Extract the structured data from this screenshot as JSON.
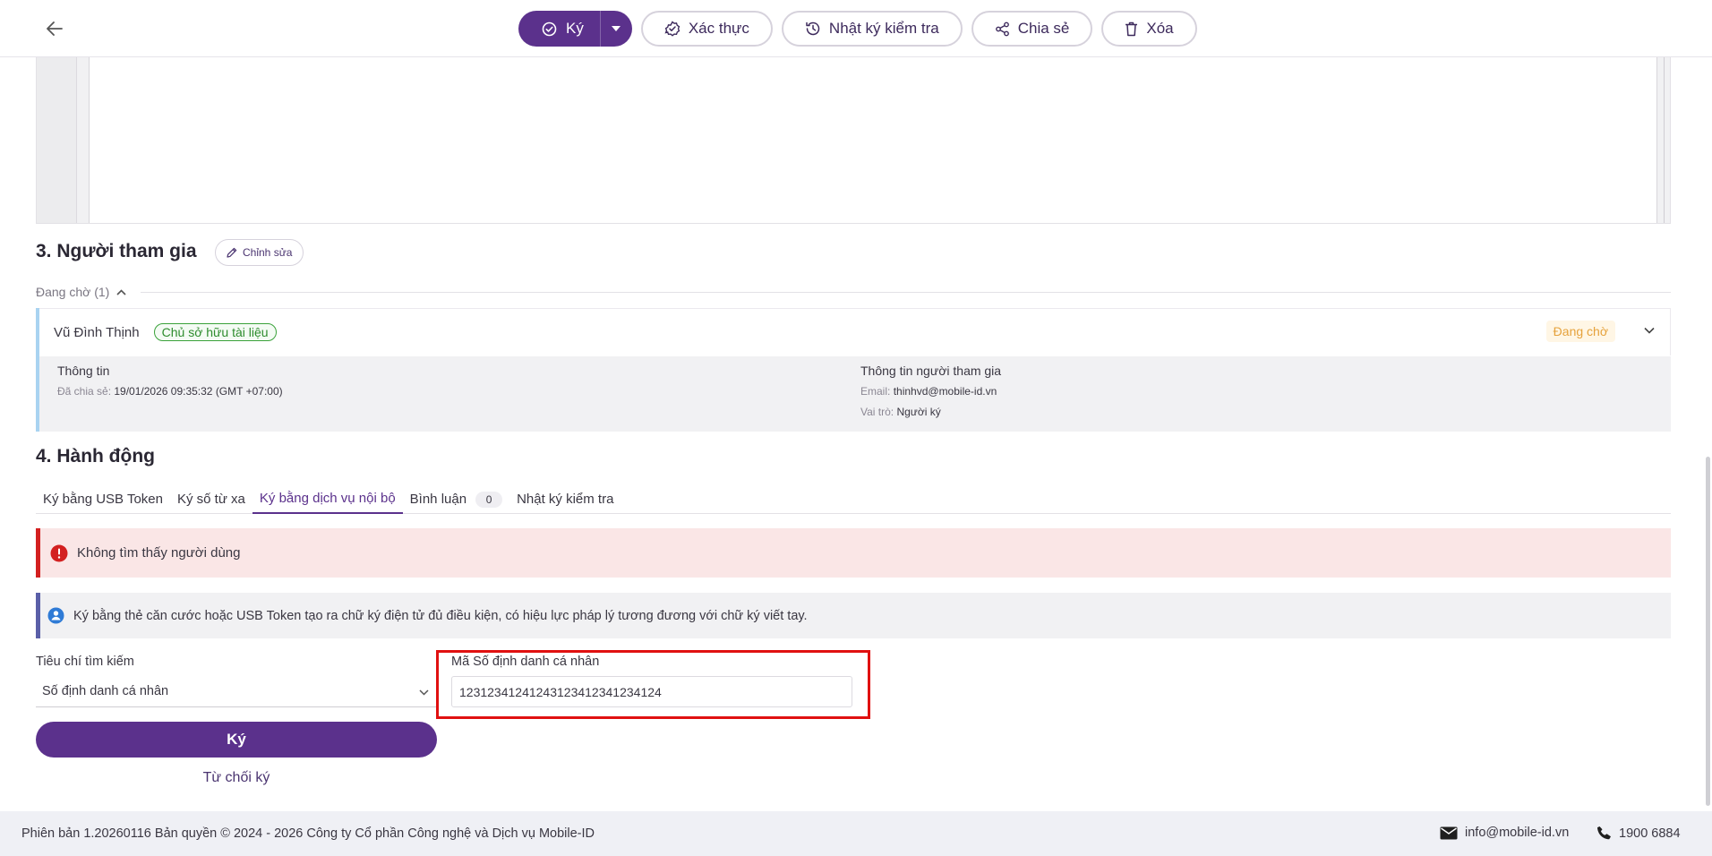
{
  "toolbar": {
    "sign_label": "Ký",
    "verify_label": "Xác thực",
    "audit_label": "Nhật ký kiểm tra",
    "share_label": "Chia sẻ",
    "delete_label": "Xóa",
    "accent": "#5b318c"
  },
  "participants_section": {
    "title": "3. Người tham gia",
    "edit_label": "Chỉnh sửa",
    "group_label": "Đang chờ (1)",
    "participant": {
      "name": "Vũ Đình Thịnh",
      "role_badge": "Chủ sở hữu tài liệu",
      "status": "Đang chờ",
      "info_heading": "Thông tin",
      "shared_label": "Đã chia sẻ:",
      "shared_value": "19/01/2026 09:35:32 (GMT +07:00)",
      "participant_heading": "Thông tin người tham gia",
      "email_label": "Email:",
      "email_value": "thinhvd@mobile-id.vn",
      "role_label": "Vai trò:",
      "role_value": "Người ký"
    }
  },
  "actions_section": {
    "title": "4. Hành động",
    "tabs": [
      {
        "label": "Ký bằng USB Token"
      },
      {
        "label": "Ký số từ xa"
      },
      {
        "label": "Ký bằng dịch vụ nội bộ"
      },
      {
        "label": "Bình luận",
        "count": "0"
      },
      {
        "label": "Nhật ký kiểm tra"
      }
    ],
    "error_message": "Không tìm thấy người dùng",
    "info_message": "Ký bằng thẻ căn cước hoặc USB Token tạo ra chữ ký điện tử đủ điều kiện, có hiệu lực pháp lý tương đương với chữ ký viết tay.",
    "search_criteria_label": "Tiêu chí tìm kiếm",
    "search_criteria_value": "Số định danh cá nhân",
    "id_label": "Mã Số định danh cá nhân",
    "id_value": "12312341241243123412341234124",
    "sign_button": "Ký",
    "reject_link": "Từ chối ký"
  },
  "footer": {
    "copyright": "Phiên bản 1.20260116 Bản quyền © 2024 - 2026 Công ty Cổ phần Công nghệ và Dịch vụ Mobile-ID",
    "email": "info@mobile-id.vn",
    "phone": "1900 6884"
  }
}
